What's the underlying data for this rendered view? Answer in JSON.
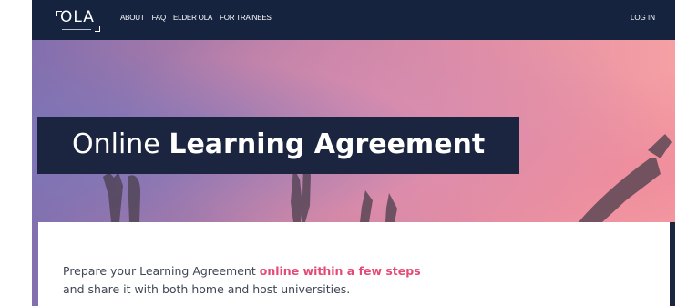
{
  "logo": {
    "text": "OLA"
  },
  "nav": {
    "links": [
      "ABOUT",
      "FAQ",
      "ELDER OLA",
      "FOR TRAINEES"
    ],
    "login": "LOG IN"
  },
  "hero": {
    "title_light": "Online",
    "title_bold": "Learning Agreement"
  },
  "card": {
    "line1_prefix": "Prepare your Learning Agreement",
    "line1_highlight": "online within a few steps",
    "line2": "and share it with both home and host universities."
  },
  "colors": {
    "navy": "#15233f",
    "accent_pink": "#e54a76"
  }
}
